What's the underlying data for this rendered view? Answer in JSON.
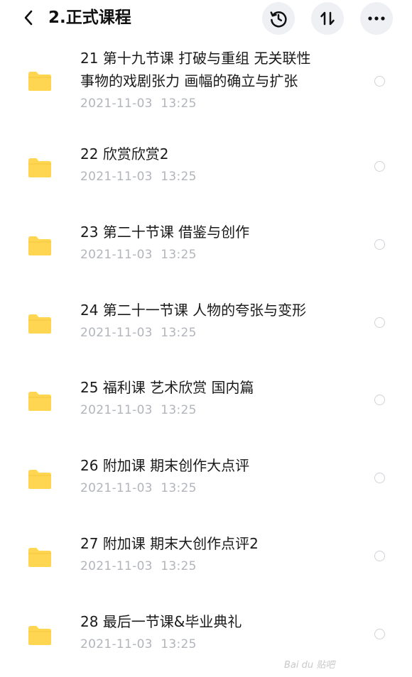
{
  "header": {
    "title": "2.正式课程",
    "back_icon": "chevron-left-icon",
    "history_icon": "history-icon",
    "sort_icon": "sort-icon",
    "more_icon": "more-horizontal-icon"
  },
  "colors": {
    "folder": "#ffd652",
    "text_primary": "#1a1a1a",
    "text_secondary": "#b2b5bb",
    "button_bg": "#eef0f3"
  },
  "items": [
    {
      "name_line1": "21 第十九节课 打破与重组 无关联性",
      "name_line2": "事物的戏剧张力 画幅的确立与扩张",
      "date": "2021-11-03",
      "time": "13:25"
    },
    {
      "name_line1": "22 欣赏欣赏2",
      "name_line2": "",
      "date": "2021-11-03",
      "time": "13:25"
    },
    {
      "name_line1": "23 第二十节课 借鉴与创作",
      "name_line2": "",
      "date": "2021-11-03",
      "time": "13:25"
    },
    {
      "name_line1": "24 第二十一节课 人物的夸张与变形",
      "name_line2": "",
      "date": "2021-11-03",
      "time": "13:25"
    },
    {
      "name_line1": "25 福利课 艺术欣赏 国内篇",
      "name_line2": "",
      "date": "2021-11-03",
      "time": "13:25"
    },
    {
      "name_line1": "26 附加课 期末创作大点评",
      "name_line2": "",
      "date": "2021-11-03",
      "time": "13:25"
    },
    {
      "name_line1": "27 附加课 期末大创作点评2",
      "name_line2": "",
      "date": "2021-11-03",
      "time": "13:25"
    },
    {
      "name_line1": "28 最后一节课&毕业典礼",
      "name_line2": "",
      "date": "2021-11-03",
      "time": "13:25"
    }
  ],
  "watermark": "Bai du 贴吧"
}
